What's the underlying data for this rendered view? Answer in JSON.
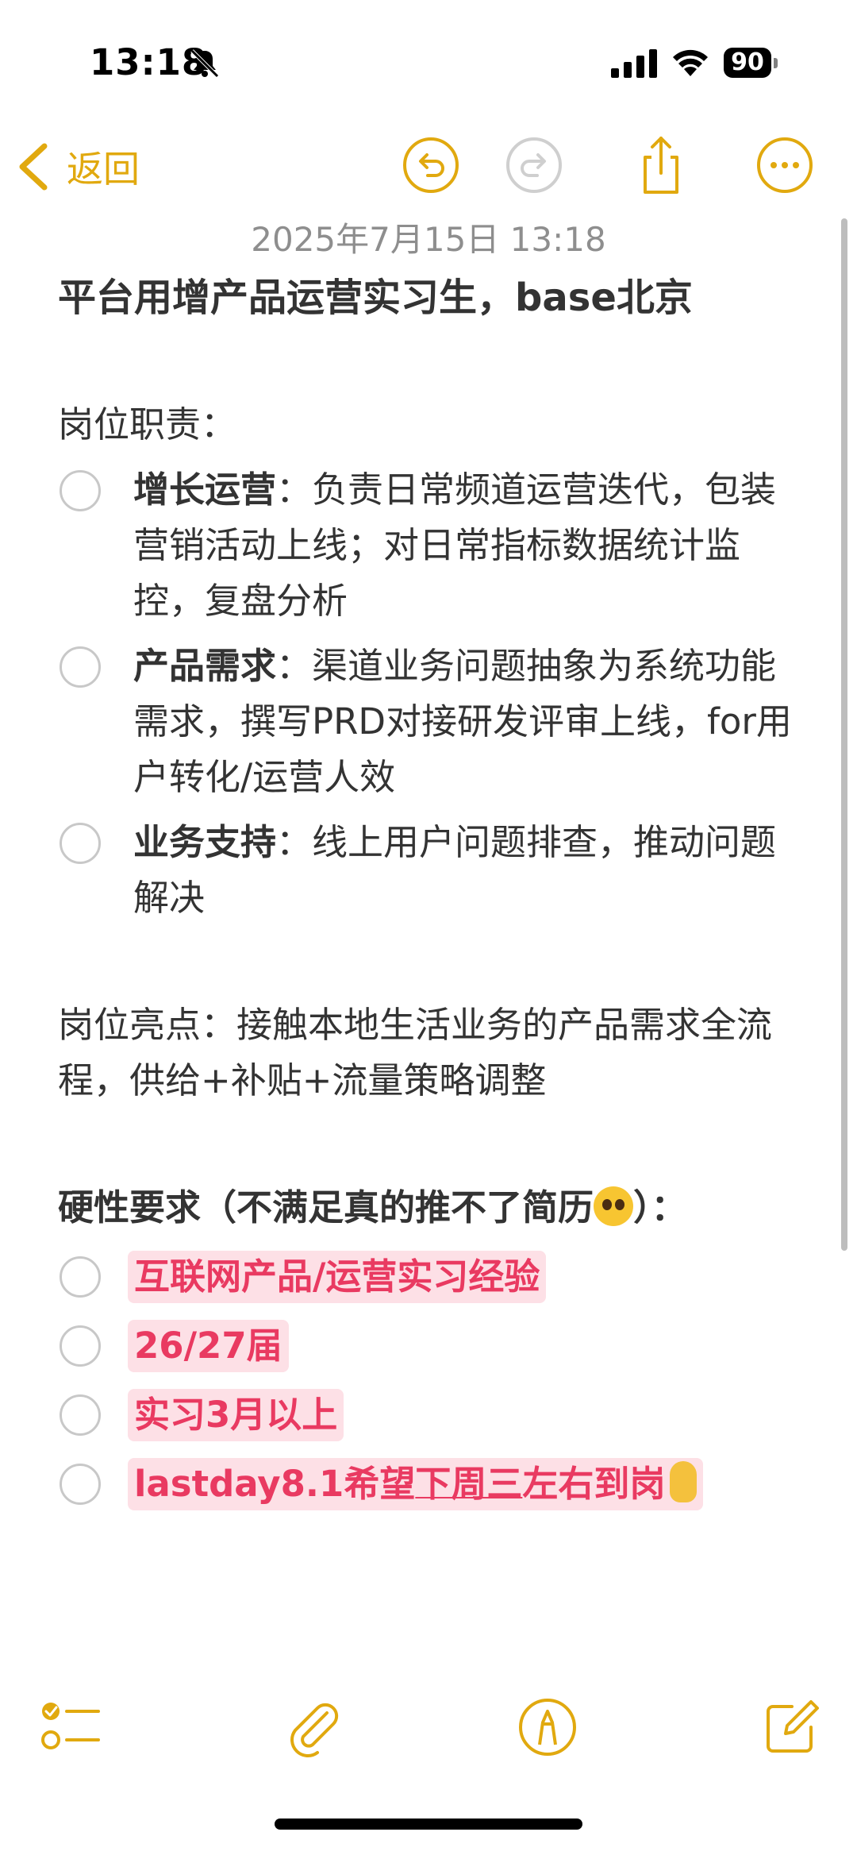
{
  "status_bar": {
    "time": "13:18",
    "battery": "90"
  },
  "nav": {
    "back_label": "返回"
  },
  "note": {
    "timestamp": "2025年7月15日 13:18",
    "title": "平台用增产品运营实习生，base北京",
    "duties_heading": "岗位职责：",
    "duties": [
      {
        "label": "增长运营",
        "text": "：负责日常频道运营迭代，包装营销活动上线；对日常指标数据统计监控，复盘分析"
      },
      {
        "label": "产品需求",
        "text": "：渠道业务问题抽象为系统功能需求，撰写PRD对接研发评审上线，for用户转化/运营人效"
      },
      {
        "label": "业务支持",
        "text": "：线上用户问题排查，推动问题解决"
      }
    ],
    "highlights": "岗位亮点：接触本地生活业务的产品需求全流程，供给+补贴+流量策略调整",
    "requirements_heading_a": "硬性要求（不满足真的推不了简历",
    "requirements_heading_b": "）：",
    "requirements": [
      "互联网产品/运营实习经验",
      "26/27届",
      "实习3月以上"
    ],
    "last_req_a": "lastday8.1希望",
    "last_req_b": "下周三",
    "last_req_c": "左右到岗"
  },
  "colors": {
    "accent": "#E1A90F",
    "highlight_bg": "#FDE0E6",
    "highlight_text": "#E93A61"
  }
}
